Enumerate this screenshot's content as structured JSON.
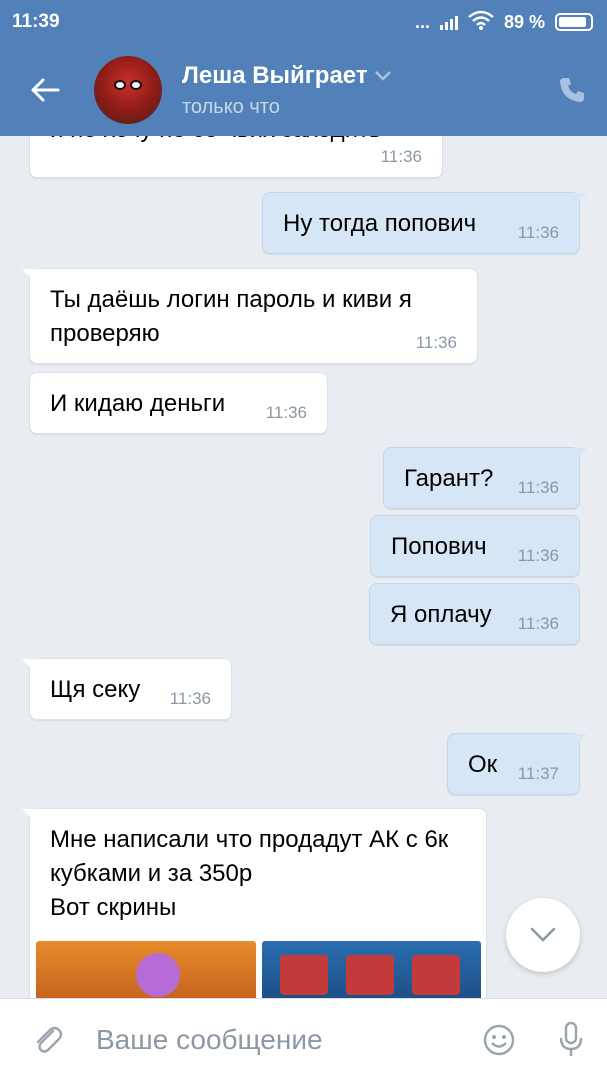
{
  "status_bar": {
    "time": "11:39",
    "dots": "...",
    "battery": "89 %"
  },
  "header": {
    "contact_name": "Леша Выйграет",
    "contact_status": "только что",
    "icons": {
      "back": "arrow-left-icon",
      "dropdown": "chevron-down-icon",
      "call": "phone-icon"
    }
  },
  "messages": [
    {
      "dir": "in",
      "text": "и не хочу не со чьих заходить",
      "time": "11:36"
    },
    {
      "dir": "out",
      "text": "Ну тогда попович",
      "time": "11:36"
    },
    {
      "dir": "in",
      "text": "Ты даёшь логин пароль и киви я проверяю",
      "time": "11:36"
    },
    {
      "dir": "in",
      "text": "И кидаю деньги",
      "time": "11:36"
    },
    {
      "dir": "out",
      "text": "Гарант?",
      "time": "11:36"
    },
    {
      "dir": "out",
      "text": "Попович",
      "time": "11:36"
    },
    {
      "dir": "out",
      "text": "Я оплачу",
      "time": "11:36"
    },
    {
      "dir": "in",
      "text": "Щя секу",
      "time": "11:36"
    },
    {
      "dir": "out",
      "text": "Ок",
      "time": "11:37"
    },
    {
      "dir": "in",
      "text": "Мне написали что продадут АК с 6к кубками и за 350р\nВот скрины",
      "time": ""
    }
  ],
  "input": {
    "placeholder": "Ваше сообщение",
    "value": ""
  },
  "colors": {
    "header_bg": "#5181b8",
    "chat_bg": "#e9edf2",
    "outgoing_bubble": "#d7e6f7",
    "incoming_bubble": "#ffffff"
  }
}
